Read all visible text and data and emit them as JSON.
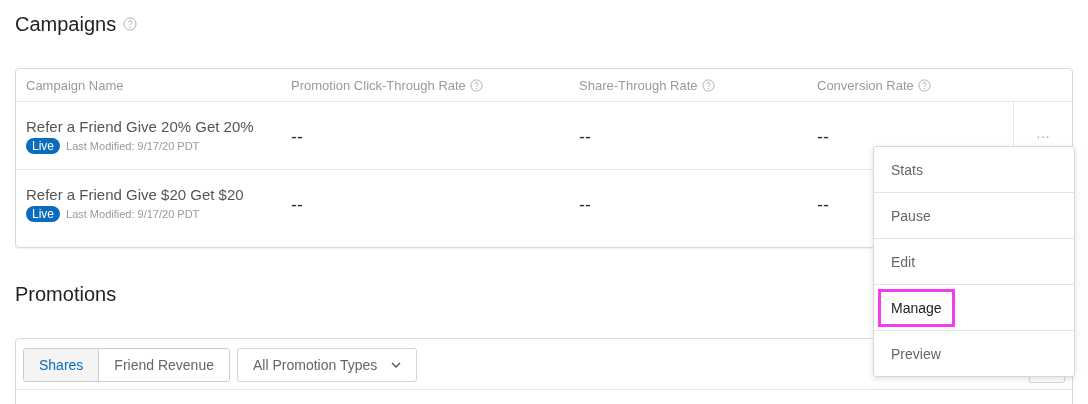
{
  "campaigns": {
    "title": "Campaigns",
    "columns": [
      {
        "label": "Campaign Name",
        "help": false
      },
      {
        "label": "Promotion Click-Through Rate",
        "help": true
      },
      {
        "label": "Share-Through Rate",
        "help": true
      },
      {
        "label": "Conversion Rate",
        "help": true
      }
    ],
    "rows": [
      {
        "name": "Refer a Friend Give 20% Get 20%",
        "status": "Live",
        "modified": "Last Modified: 9/17/20 PDT",
        "ctr": "--",
        "str": "--",
        "conversion": "--",
        "menu_open": true
      },
      {
        "name": "Refer a Friend Give $20 Get $20",
        "status": "Live",
        "modified": "Last Modified: 9/17/20 PDT",
        "ctr": "--",
        "str": "--",
        "conversion": "--",
        "menu_open": false
      }
    ],
    "actions_icon": "···",
    "menu": [
      {
        "label": "Stats",
        "highlighted": false
      },
      {
        "label": "Pause",
        "highlighted": false
      },
      {
        "label": "Edit",
        "highlighted": false
      },
      {
        "label": "Manage",
        "highlighted": true
      },
      {
        "label": "Preview",
        "highlighted": false
      }
    ]
  },
  "promotions": {
    "title": "Promotions",
    "tabs": [
      {
        "label": "Shares",
        "selected": true
      },
      {
        "label": "Friend Revenue",
        "selected": false
      }
    ],
    "filter": {
      "value": "All Promotion Types"
    }
  }
}
